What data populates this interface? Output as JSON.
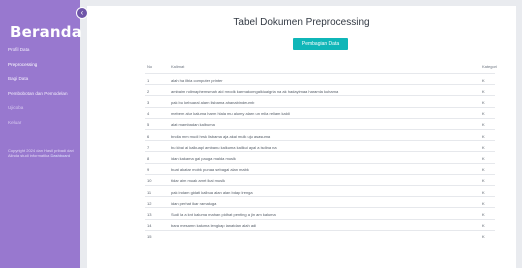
{
  "sidebar": {
    "brand": "Beranda",
    "items": [
      {
        "label": "Profil Data"
      },
      {
        "label": "Preprocessing"
      },
      {
        "label": "Bagi Data"
      },
      {
        "label": "Pembobotan dan Pemodelan"
      },
      {
        "label": "Ujicoba"
      },
      {
        "label": "Keluar"
      }
    ],
    "note": "Copyright 2024 dan Hasil pribadi dari Alinda studi informatika",
    "note_link": "Dashboard"
  },
  "main": {
    "title": "Tabel Dokumen Preprocessing",
    "button_label": "Pembagian Data",
    "columns": {
      "no": "No",
      "text": "Kalimat",
      "label": "Kategori"
    },
    "rows": [
      {
        "no": "1",
        "text": "alah ha ilbia computer printer",
        "label": "K"
      },
      {
        "no": "2",
        "text": "ambaim ndimaphemsmah aid mrodk karmakomgalkiuaigria na ak hadayimaa haramla kuhama",
        "label": "K"
      },
      {
        "no": "3",
        "text": "pak bu kebuaral alarn lisbama ahanabindeurnb",
        "label": "K"
      },
      {
        "no": "4",
        "text": "mebem alur kaluma harm hlala mu alumy alarn un mlia reliam kaldi",
        "label": "K"
      },
      {
        "no": "5",
        "text": "alat mambadan kalbuma",
        "label": "K"
      },
      {
        "no": "6",
        "text": "bndia mm mudi hrsk lisbama aja akai mulk uju asasuma",
        "label": "K"
      },
      {
        "no": "7",
        "text": "bu kbai ai kalkuapl ambanu kalkuma kailkui ayal a isdina na",
        "label": "K"
      },
      {
        "no": "8",
        "text": "idan kakama gai pauga malda muslk",
        "label": "K"
      },
      {
        "no": "9",
        "text": "buat akatar mobk punaa sebagai alan mabk",
        "label": "K"
      },
      {
        "no": "10",
        "text": "tidar aim muak amrt ikai muslk",
        "label": "K"
      },
      {
        "no": "11",
        "text": "pak indam gidati kalbua alan alan bdap lrenga",
        "label": "K"
      },
      {
        "no": "12",
        "text": "idan perhat ikar ramaluga",
        "label": "K"
      },
      {
        "no": "13",
        "text": "Sudi la a knt kaluma mahan pidhat penting a jin am kaluma",
        "label": "K"
      },
      {
        "no": "14",
        "text": "bara mesamn kaluma lengkap ianatdan alah adi",
        "label": "K"
      },
      {
        "no": "15",
        "text": "",
        "label": "K"
      }
    ]
  }
}
